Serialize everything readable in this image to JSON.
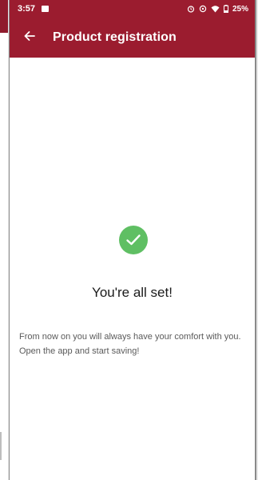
{
  "statusbar": {
    "time": "3:57",
    "battery": "25%"
  },
  "appbar": {
    "back_icon": "arrow-left",
    "title": "Product registration"
  },
  "confirmation": {
    "icon": "check-circle",
    "icon_color": "#5fbf63",
    "headline": "You're all set!",
    "message": "From now on you will always have your comfort with you. Open the app and start saving!"
  },
  "colors": {
    "brand": "#9b1c2f"
  }
}
